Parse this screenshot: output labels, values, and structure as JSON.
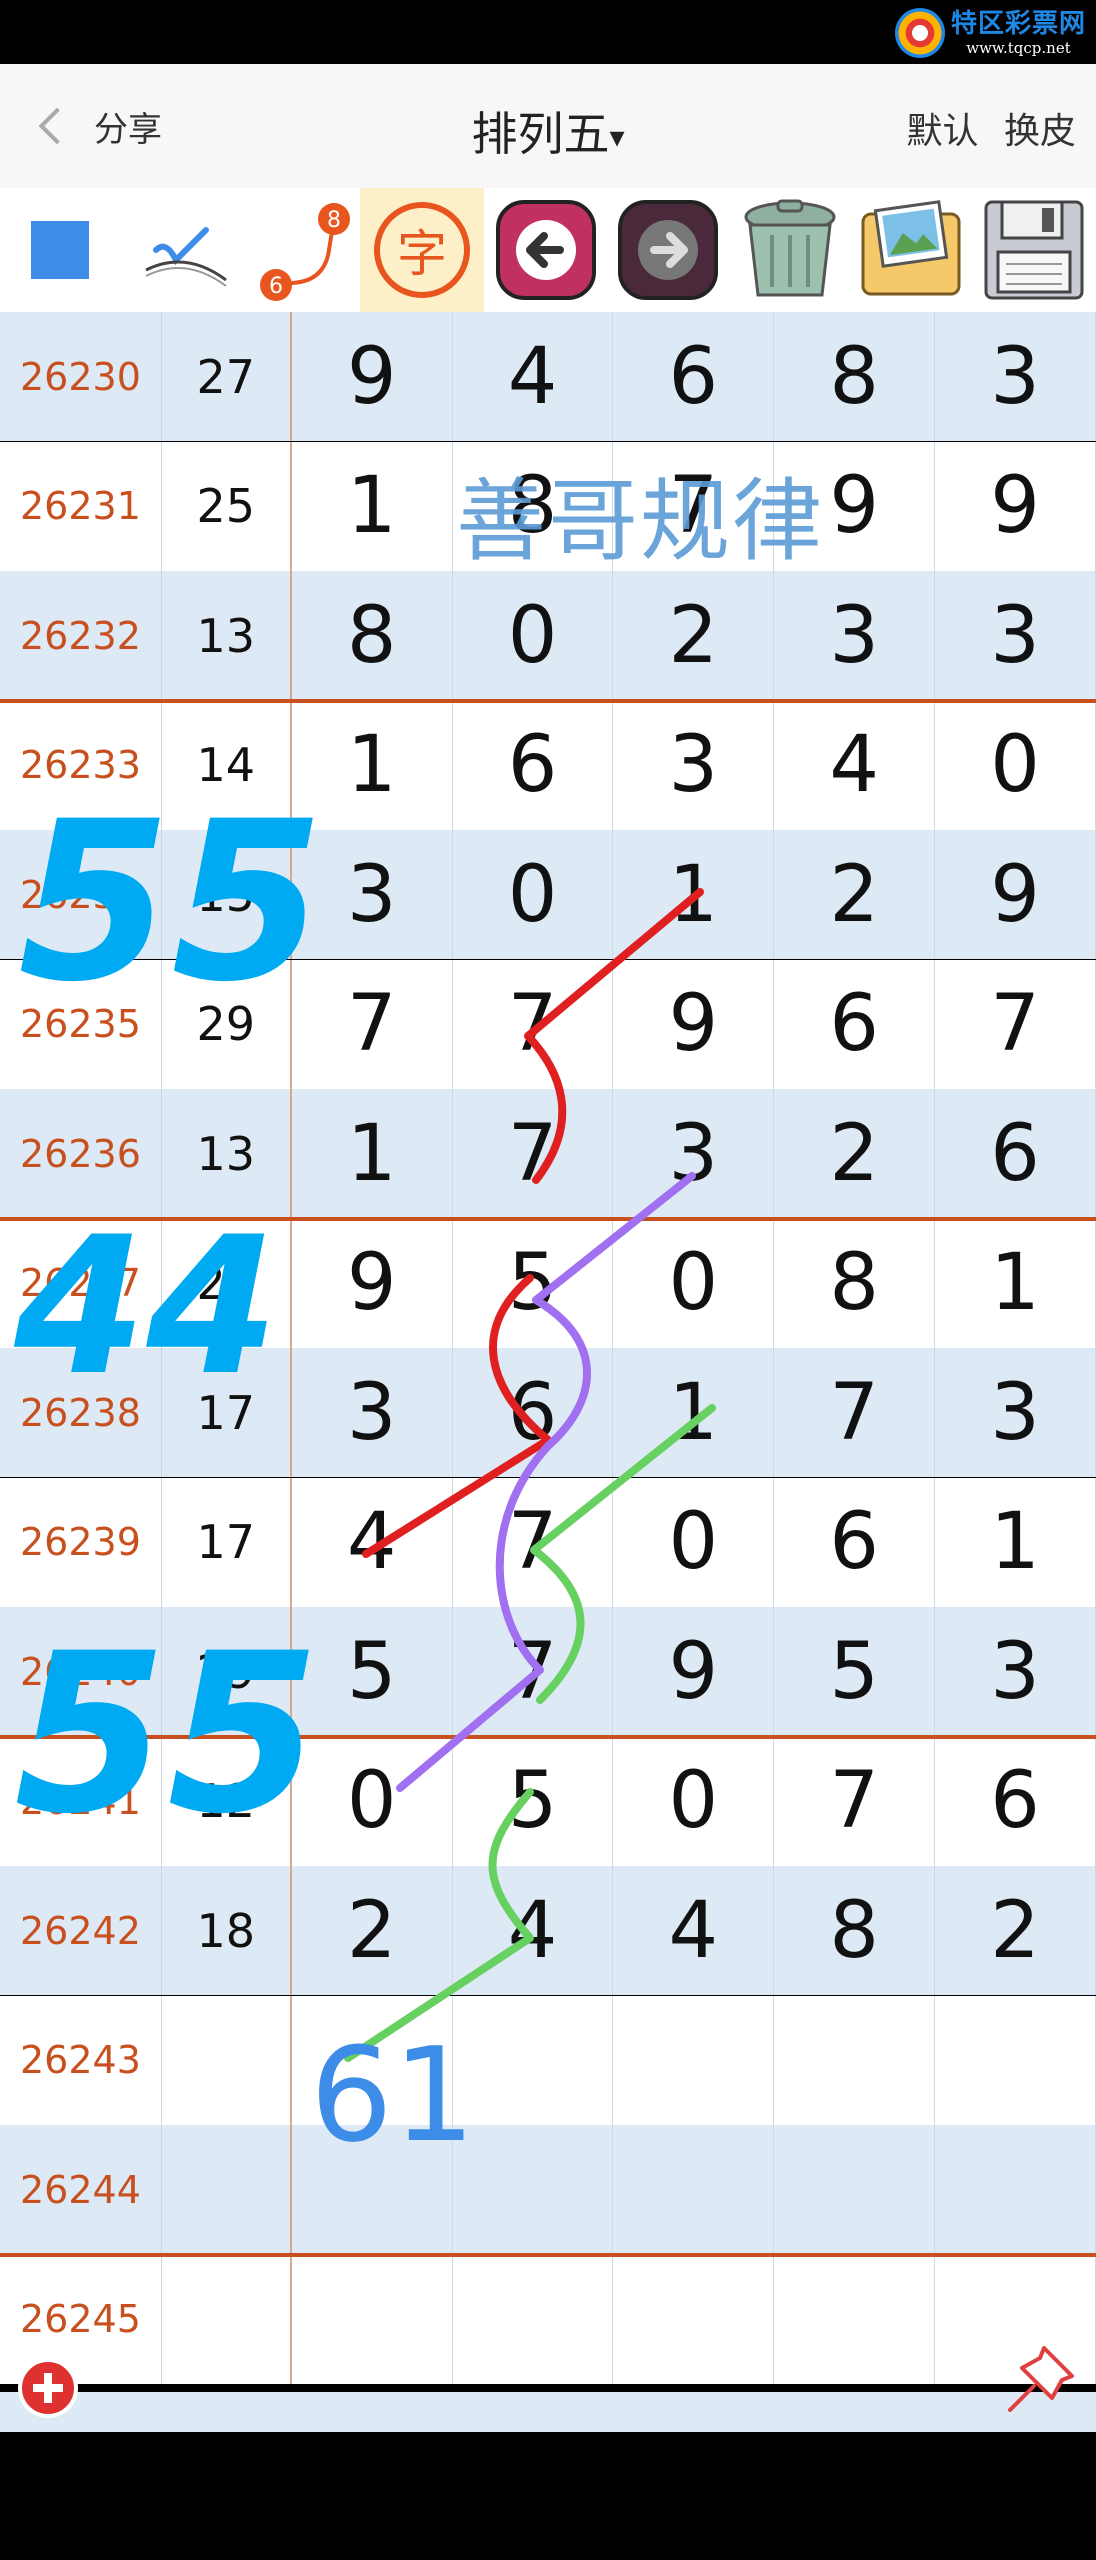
{
  "watermark": {
    "name": "特区彩票网",
    "url": "www.tqcp.net"
  },
  "header": {
    "back_label": "分享",
    "title": "排列五",
    "title_caret": "▾",
    "default_label": "默认",
    "skin_label": "换皮"
  },
  "toolbar": {
    "icons": [
      "blue-square-icon",
      "pen-check-icon",
      "connect-six-eight-icon",
      "zi-character-icon",
      "undo-arrow-icon",
      "redo-arrow-icon",
      "trash-bin-icon",
      "photo-album-icon",
      "floppy-save-icon"
    ],
    "connect_numbers": [
      "8",
      "6"
    ],
    "zi_char": "字"
  },
  "rows": [
    {
      "issue": "26230",
      "sum": "27",
      "digits": [
        "9",
        "4",
        "6",
        "8",
        "3"
      ]
    },
    {
      "issue": "26231",
      "sum": "25",
      "digits": [
        "1",
        "8",
        "7",
        "9",
        "9"
      ]
    },
    {
      "issue": "26232",
      "sum": "13",
      "digits": [
        "8",
        "0",
        "2",
        "3",
        "3"
      ]
    },
    {
      "issue": "26233",
      "sum": "14",
      "digits": [
        "1",
        "6",
        "3",
        "4",
        "0"
      ]
    },
    {
      "issue": "26234",
      "sum": "15",
      "digits": [
        "3",
        "0",
        "1",
        "2",
        "9"
      ]
    },
    {
      "issue": "26235",
      "sum": "29",
      "digits": [
        "7",
        "7",
        "9",
        "6",
        "7"
      ]
    },
    {
      "issue": "26236",
      "sum": "13",
      "digits": [
        "1",
        "7",
        "3",
        "2",
        "6"
      ]
    },
    {
      "issue": "26237",
      "sum": "22",
      "digits": [
        "9",
        "5",
        "0",
        "8",
        "1"
      ]
    },
    {
      "issue": "26238",
      "sum": "17",
      "digits": [
        "3",
        "6",
        "1",
        "7",
        "3"
      ]
    },
    {
      "issue": "26239",
      "sum": "17",
      "digits": [
        "4",
        "7",
        "0",
        "6",
        "1"
      ]
    },
    {
      "issue": "26240",
      "sum": "29",
      "digits": [
        "5",
        "7",
        "9",
        "5",
        "3"
      ]
    },
    {
      "issue": "26241",
      "sum": "12",
      "digits": [
        "0",
        "5",
        "0",
        "7",
        "6"
      ]
    },
    {
      "issue": "26242",
      "sum": "18",
      "digits": [
        "2",
        "4",
        "4",
        "8",
        "2"
      ]
    },
    {
      "issue": "26243",
      "sum": "",
      "digits": [
        "",
        "",
        "",
        "",
        ""
      ]
    },
    {
      "issue": "26244",
      "sum": "",
      "digits": [
        "",
        "",
        "",
        "",
        ""
      ]
    },
    {
      "issue": "26245",
      "sum": "",
      "digits": [
        "",
        "",
        "",
        "",
        ""
      ]
    }
  ],
  "annotations": {
    "rule_label": "善哥规律",
    "marks": [
      "55",
      "44",
      "55",
      "61"
    ],
    "colors": {
      "red": "#e02020",
      "purple": "#a070f0",
      "green": "#66d060",
      "cyan": "#00aaf2",
      "blue": "#3c8ce8"
    }
  },
  "colors": {
    "issue_text": "#c8501e",
    "row_shade": "#ddeaf6",
    "separator": "#c8501e",
    "tool_square": "#3c8ce8"
  }
}
